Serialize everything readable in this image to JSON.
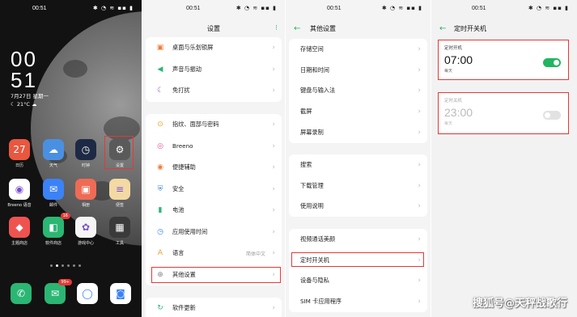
{
  "status": {
    "time": "00:51",
    "icons": "✱ ◔ ≋ ▪▪ ▮"
  },
  "home": {
    "clock_hour": "00",
    "clock_minute": "51",
    "date": "7月27日 星期一",
    "weather": "☾ 21°C ☁",
    "apps": [
      {
        "label": "日历",
        "glyph": "27",
        "color": "#e9573f"
      },
      {
        "label": "天气",
        "glyph": "☁",
        "color": "#4a90e2"
      },
      {
        "label": "时钟",
        "glyph": "◷",
        "color": "#1e2a44"
      },
      {
        "label": "设置",
        "glyph": "⚙",
        "color": "#5a5a5a"
      },
      {
        "label": "Breeno 语音",
        "glyph": "◉",
        "color": "#ffffff"
      },
      {
        "label": "邮件",
        "glyph": "✉",
        "color": "#3b82f6"
      },
      {
        "label": "相册",
        "glyph": "▣",
        "color": "#ef6b55"
      },
      {
        "label": "便签",
        "glyph": "≡",
        "color": "#f3d9a4"
      },
      {
        "label": "主题商店",
        "glyph": "◆",
        "color": "#ef5350"
      },
      {
        "label": "软件商店",
        "glyph": "◧",
        "color": "#2bb673",
        "badge": "16"
      },
      {
        "label": "游戏中心",
        "glyph": "✿",
        "color": "#f5f5f5"
      },
      {
        "label": "工具",
        "glyph": "▦",
        "color": "#3a3a3a"
      }
    ],
    "dock": [
      {
        "glyph": "✆",
        "color": "#2bb673"
      },
      {
        "glyph": "✉",
        "color": "#2bb673",
        "badge": "99+"
      },
      {
        "glyph": "◯",
        "color": "#ffffff"
      },
      {
        "glyph": "◙",
        "color": "#ffffff"
      }
    ]
  },
  "settings": {
    "title": "设置",
    "group1": [
      {
        "label": "桌面与乐划锁屏",
        "icon": "▣",
        "color": "#f27b3a"
      },
      {
        "label": "声音与振动",
        "icon": "◀",
        "color": "#2bb673"
      },
      {
        "label": "免打扰",
        "icon": "☾",
        "color": "#8e5ad6"
      }
    ],
    "group2": [
      {
        "label": "指纹、面部与密码",
        "icon": "⊙",
        "color": "#f0a030"
      },
      {
        "label": "Breeno",
        "icon": "◎",
        "color": "#e54b8f"
      },
      {
        "label": "便捷辅助",
        "icon": "◉",
        "color": "#f27b3a"
      },
      {
        "label": "安全",
        "icon": "⛨",
        "color": "#3b82f6"
      },
      {
        "label": "电池",
        "icon": "▮",
        "color": "#2bb673"
      },
      {
        "label": "应用使用时间",
        "icon": "◷",
        "color": "#3b82f6"
      },
      {
        "label": "语言",
        "icon": "A",
        "color": "#f0a030",
        "value": "简体中文"
      },
      {
        "label": "其他设置",
        "icon": "⊕",
        "color": "#888888"
      }
    ],
    "group3": [
      {
        "label": "软件更新",
        "icon": "↻",
        "color": "#2bb673"
      }
    ]
  },
  "other": {
    "title": "其他设置",
    "group1": [
      "存储空间",
      "日期和时间",
      "键盘与输入法",
      "截屏",
      "屏幕录制"
    ],
    "group2": [
      "搜索",
      "下载管理",
      "使用说明"
    ],
    "group3": [
      "视频通话美颜",
      "定时开关机",
      "设备与隐私",
      "SIM 卡应用程序"
    ]
  },
  "timer": {
    "title": "定时开关机",
    "on": {
      "title": "定时开机",
      "time": "07:00",
      "sub": "每天",
      "enabled": true
    },
    "off": {
      "title": "定时关机",
      "time": "23:00",
      "sub": "每天",
      "enabled": false
    }
  },
  "watermark": "搜狐号@天秤战歌行",
  "colors": {
    "accent": "#22b560",
    "highlight": "#e53935"
  }
}
